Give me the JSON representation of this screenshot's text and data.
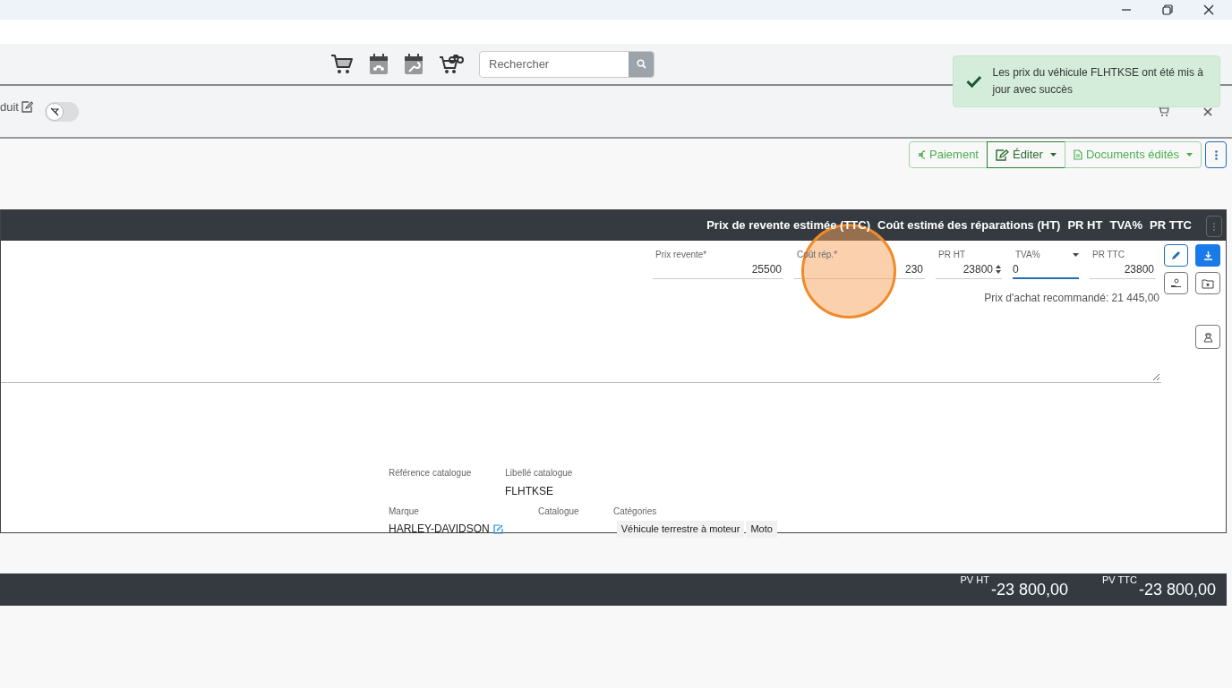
{
  "toolbar": {
    "search": {
      "placeholder": "Rechercher"
    }
  },
  "subheader": {
    "label": "duit",
    "toggle": {
      "on": false
    }
  },
  "toast": {
    "message": "Les prix du véhicule FLHTKSE ont été mis à jour avec succès"
  },
  "actions": [
    {
      "label": "Paiement",
      "dropdown": false,
      "active": false
    },
    {
      "label": "Éditer",
      "dropdown": true,
      "active": true
    },
    {
      "label": "Documents édités",
      "dropdown": true,
      "active": false
    }
  ],
  "table": {
    "columns": [
      "Prix de revente estimée (TTC)",
      "Coût estimé des réparations (HT)",
      "PR HT",
      "TVA%",
      "PR TTC"
    ]
  },
  "fields": [
    {
      "label": "Prix revente*",
      "value": "25500",
      "kind": "text",
      "focused": false
    },
    {
      "label": "Coût rép.*",
      "value": "230",
      "kind": "text",
      "focused": false
    },
    {
      "label": "PR HT",
      "value": "23800",
      "kind": "spin",
      "focused": false
    },
    {
      "label": "TVA%",
      "value": "0",
      "kind": "select",
      "focused": true
    },
    {
      "label": "PR TTC",
      "value": "23800",
      "kind": "text",
      "focused": false
    }
  ],
  "recommended": "Prix d'achat recommandé: 21 445,00",
  "catalog": {
    "reference_label": "Référence catalogue",
    "libelle_label": "Libellé catalogue",
    "libelle": "FLHTKSE",
    "marque_label": "Marque",
    "marque": "HARLEY-DAVIDSON",
    "catalogue_label": "Catalogue",
    "categories_label": "Catégories",
    "categories": [
      "Véhicule terrestre à moteur",
      "Moto"
    ]
  },
  "totals": [
    {
      "label": "PV HT",
      "value": "-23 800,00"
    },
    {
      "label": "PV TTC",
      "value": "-23 800,00"
    }
  ]
}
